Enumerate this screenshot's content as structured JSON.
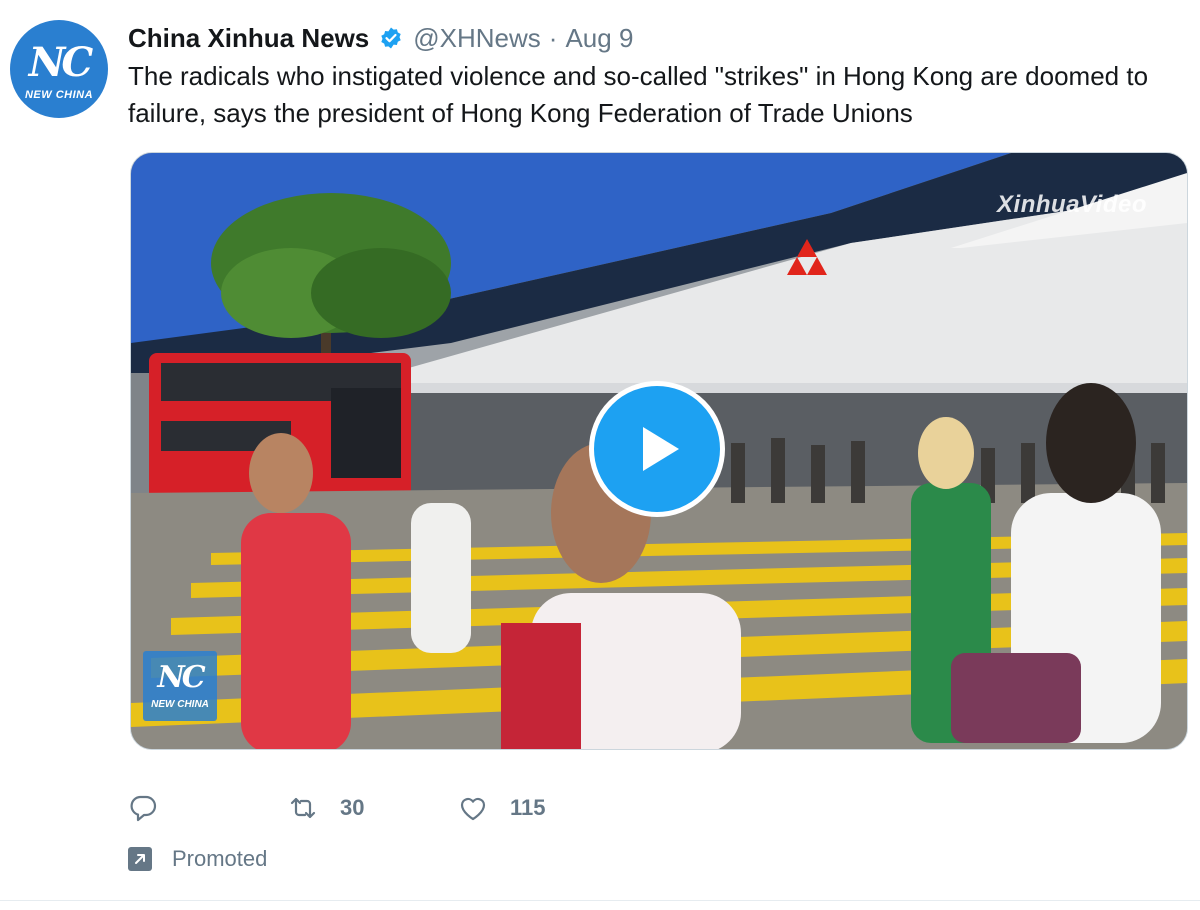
{
  "author": {
    "display_name": "China Xinhua News",
    "handle": "@XHNews",
    "separator": "·",
    "date": "Aug 9",
    "avatar_mark": "NC",
    "avatar_brand": "NEW CHINA",
    "verified": true
  },
  "tweet": {
    "text": "The radicals who instigated violence and so-called \"strikes\" in Hong Kong are doomed to failure, says the president of Hong Kong Federation of Trade Unions"
  },
  "media": {
    "type": "video",
    "watermark_top": "XinhuaVideo",
    "logo_mark": "NC",
    "logo_brand": "NEW CHINA",
    "play_icon": "play-icon"
  },
  "actions": {
    "reply": {
      "icon": "reply-icon",
      "count": ""
    },
    "retweet": {
      "icon": "retweet-icon",
      "count": "30"
    },
    "like": {
      "icon": "heart-icon",
      "count": "115"
    }
  },
  "promoted": {
    "icon": "promoted-arrow-icon",
    "label": "Promoted"
  },
  "colors": {
    "accent": "#1da1f2",
    "secondary_text": "#657786",
    "primary_text": "#14171a",
    "avatar_blue": "#2a7fd0"
  }
}
